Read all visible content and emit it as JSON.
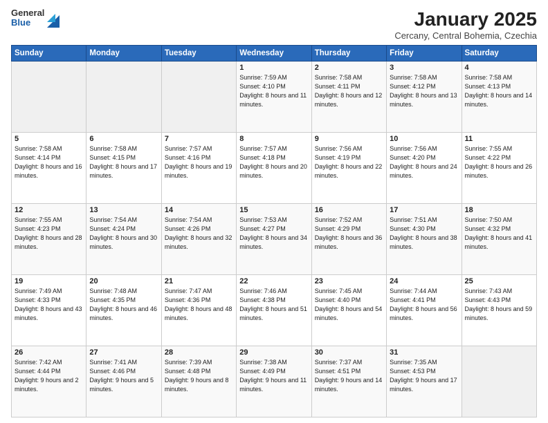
{
  "header": {
    "logo": {
      "general": "General",
      "blue": "Blue"
    },
    "title": "January 2025",
    "subtitle": "Cercany, Central Bohemia, Czechia"
  },
  "weekdays": [
    "Sunday",
    "Monday",
    "Tuesday",
    "Wednesday",
    "Thursday",
    "Friday",
    "Saturday"
  ],
  "weeks": [
    [
      {
        "day": null,
        "sunrise": null,
        "sunset": null,
        "daylight": null
      },
      {
        "day": null,
        "sunrise": null,
        "sunset": null,
        "daylight": null
      },
      {
        "day": null,
        "sunrise": null,
        "sunset": null,
        "daylight": null
      },
      {
        "day": "1",
        "sunrise": "Sunrise: 7:59 AM",
        "sunset": "Sunset: 4:10 PM",
        "daylight": "Daylight: 8 hours and 11 minutes."
      },
      {
        "day": "2",
        "sunrise": "Sunrise: 7:58 AM",
        "sunset": "Sunset: 4:11 PM",
        "daylight": "Daylight: 8 hours and 12 minutes."
      },
      {
        "day": "3",
        "sunrise": "Sunrise: 7:58 AM",
        "sunset": "Sunset: 4:12 PM",
        "daylight": "Daylight: 8 hours and 13 minutes."
      },
      {
        "day": "4",
        "sunrise": "Sunrise: 7:58 AM",
        "sunset": "Sunset: 4:13 PM",
        "daylight": "Daylight: 8 hours and 14 minutes."
      }
    ],
    [
      {
        "day": "5",
        "sunrise": "Sunrise: 7:58 AM",
        "sunset": "Sunset: 4:14 PM",
        "daylight": "Daylight: 8 hours and 16 minutes."
      },
      {
        "day": "6",
        "sunrise": "Sunrise: 7:58 AM",
        "sunset": "Sunset: 4:15 PM",
        "daylight": "Daylight: 8 hours and 17 minutes."
      },
      {
        "day": "7",
        "sunrise": "Sunrise: 7:57 AM",
        "sunset": "Sunset: 4:16 PM",
        "daylight": "Daylight: 8 hours and 19 minutes."
      },
      {
        "day": "8",
        "sunrise": "Sunrise: 7:57 AM",
        "sunset": "Sunset: 4:18 PM",
        "daylight": "Daylight: 8 hours and 20 minutes."
      },
      {
        "day": "9",
        "sunrise": "Sunrise: 7:56 AM",
        "sunset": "Sunset: 4:19 PM",
        "daylight": "Daylight: 8 hours and 22 minutes."
      },
      {
        "day": "10",
        "sunrise": "Sunrise: 7:56 AM",
        "sunset": "Sunset: 4:20 PM",
        "daylight": "Daylight: 8 hours and 24 minutes."
      },
      {
        "day": "11",
        "sunrise": "Sunrise: 7:55 AM",
        "sunset": "Sunset: 4:22 PM",
        "daylight": "Daylight: 8 hours and 26 minutes."
      }
    ],
    [
      {
        "day": "12",
        "sunrise": "Sunrise: 7:55 AM",
        "sunset": "Sunset: 4:23 PM",
        "daylight": "Daylight: 8 hours and 28 minutes."
      },
      {
        "day": "13",
        "sunrise": "Sunrise: 7:54 AM",
        "sunset": "Sunset: 4:24 PM",
        "daylight": "Daylight: 8 hours and 30 minutes."
      },
      {
        "day": "14",
        "sunrise": "Sunrise: 7:54 AM",
        "sunset": "Sunset: 4:26 PM",
        "daylight": "Daylight: 8 hours and 32 minutes."
      },
      {
        "day": "15",
        "sunrise": "Sunrise: 7:53 AM",
        "sunset": "Sunset: 4:27 PM",
        "daylight": "Daylight: 8 hours and 34 minutes."
      },
      {
        "day": "16",
        "sunrise": "Sunrise: 7:52 AM",
        "sunset": "Sunset: 4:29 PM",
        "daylight": "Daylight: 8 hours and 36 minutes."
      },
      {
        "day": "17",
        "sunrise": "Sunrise: 7:51 AM",
        "sunset": "Sunset: 4:30 PM",
        "daylight": "Daylight: 8 hours and 38 minutes."
      },
      {
        "day": "18",
        "sunrise": "Sunrise: 7:50 AM",
        "sunset": "Sunset: 4:32 PM",
        "daylight": "Daylight: 8 hours and 41 minutes."
      }
    ],
    [
      {
        "day": "19",
        "sunrise": "Sunrise: 7:49 AM",
        "sunset": "Sunset: 4:33 PM",
        "daylight": "Daylight: 8 hours and 43 minutes."
      },
      {
        "day": "20",
        "sunrise": "Sunrise: 7:48 AM",
        "sunset": "Sunset: 4:35 PM",
        "daylight": "Daylight: 8 hours and 46 minutes."
      },
      {
        "day": "21",
        "sunrise": "Sunrise: 7:47 AM",
        "sunset": "Sunset: 4:36 PM",
        "daylight": "Daylight: 8 hours and 48 minutes."
      },
      {
        "day": "22",
        "sunrise": "Sunrise: 7:46 AM",
        "sunset": "Sunset: 4:38 PM",
        "daylight": "Daylight: 8 hours and 51 minutes."
      },
      {
        "day": "23",
        "sunrise": "Sunrise: 7:45 AM",
        "sunset": "Sunset: 4:40 PM",
        "daylight": "Daylight: 8 hours and 54 minutes."
      },
      {
        "day": "24",
        "sunrise": "Sunrise: 7:44 AM",
        "sunset": "Sunset: 4:41 PM",
        "daylight": "Daylight: 8 hours and 56 minutes."
      },
      {
        "day": "25",
        "sunrise": "Sunrise: 7:43 AM",
        "sunset": "Sunset: 4:43 PM",
        "daylight": "Daylight: 8 hours and 59 minutes."
      }
    ],
    [
      {
        "day": "26",
        "sunrise": "Sunrise: 7:42 AM",
        "sunset": "Sunset: 4:44 PM",
        "daylight": "Daylight: 9 hours and 2 minutes."
      },
      {
        "day": "27",
        "sunrise": "Sunrise: 7:41 AM",
        "sunset": "Sunset: 4:46 PM",
        "daylight": "Daylight: 9 hours and 5 minutes."
      },
      {
        "day": "28",
        "sunrise": "Sunrise: 7:39 AM",
        "sunset": "Sunset: 4:48 PM",
        "daylight": "Daylight: 9 hours and 8 minutes."
      },
      {
        "day": "29",
        "sunrise": "Sunrise: 7:38 AM",
        "sunset": "Sunset: 4:49 PM",
        "daylight": "Daylight: 9 hours and 11 minutes."
      },
      {
        "day": "30",
        "sunrise": "Sunrise: 7:37 AM",
        "sunset": "Sunset: 4:51 PM",
        "daylight": "Daylight: 9 hours and 14 minutes."
      },
      {
        "day": "31",
        "sunrise": "Sunrise: 7:35 AM",
        "sunset": "Sunset: 4:53 PM",
        "daylight": "Daylight: 9 hours and 17 minutes."
      },
      {
        "day": null,
        "sunrise": null,
        "sunset": null,
        "daylight": null
      }
    ]
  ]
}
